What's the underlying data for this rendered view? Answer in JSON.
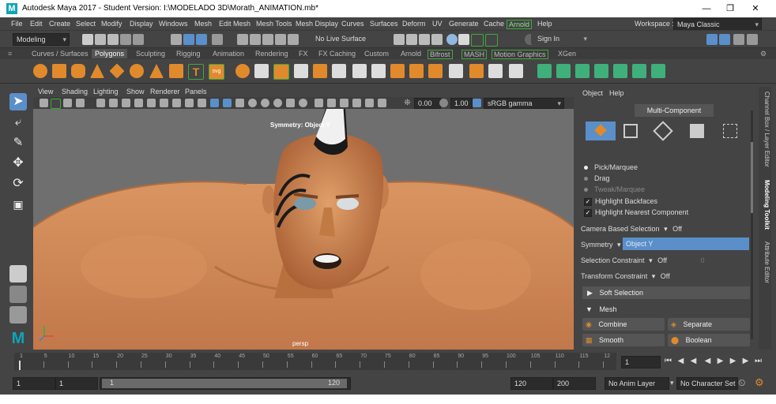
{
  "window": {
    "title": "Autodesk Maya 2017 - Student Version: I:\\MODELADO 3D\\Morath_ANIMATION.mb*",
    "app_icon": "M"
  },
  "menubar": {
    "items": [
      "File",
      "Edit",
      "Create",
      "Select",
      "Modify",
      "Display",
      "Windows",
      "Mesh",
      "Edit Mesh",
      "Mesh Tools",
      "Mesh Display",
      "Curves",
      "Surfaces",
      "Deform",
      "UV",
      "Generate",
      "Cache",
      "Arnold",
      "Help"
    ],
    "workspace_label": "Workspace :",
    "workspace_value": "Maya Classic"
  },
  "statusline": {
    "mode": "Modeling",
    "live_surface": "No Live Surface",
    "sign_in": "Sign In"
  },
  "shelf": {
    "tabs": [
      "Curves / Surfaces",
      "Polygons",
      "Sculpting",
      "Rigging",
      "Animation",
      "Rendering",
      "FX",
      "FX Caching",
      "Custom",
      "Arnold",
      "Bifrost",
      "MASH",
      "Motion Graphics",
      "XGen"
    ],
    "active_tab": "Polygons"
  },
  "viewport": {
    "menu": [
      "View",
      "Shading",
      "Lighting",
      "Show",
      "Renderer",
      "Panels"
    ],
    "exposure": "0.00",
    "gamma": "1.00",
    "color_space": "sRGB gamma",
    "symmetry_label": "Symmetry: Object Y",
    "camera_label": "persp"
  },
  "toolkit": {
    "menu": [
      "Object",
      "Help"
    ],
    "header": "Multi-Component",
    "pick_marquee": "Pick/Marquee",
    "drag": "Drag",
    "tweak_marquee": "Tweak/Marquee",
    "highlight_backfaces": "Highlight Backfaces",
    "highlight_nearest": "Highlight Nearest Component",
    "camera_based_label": "Camera Based Selection",
    "camera_based_value": "Off",
    "symmetry_label": "Symmetry",
    "symmetry_value": "Object Y",
    "selection_constraint_label": "Selection Constraint",
    "selection_constraint_value": "Off",
    "selection_constraint_num": "0",
    "transform_constraint_label": "Transform Constraint",
    "transform_constraint_value": "Off",
    "soft_selection": "Soft Selection",
    "mesh_section": "Mesh",
    "combine": "Combine",
    "separate": "Separate",
    "smooth": "Smooth",
    "boolean": "Boolean"
  },
  "side_tabs": [
    "Channel Box / Layer Editor",
    "Modeling Toolkit",
    "Attribute Editor"
  ],
  "timeline": {
    "ticks": [
      "1",
      "5",
      "10",
      "15",
      "20",
      "25",
      "30",
      "35",
      "40",
      "45",
      "50",
      "55",
      "60",
      "65",
      "70",
      "75",
      "80",
      "85",
      "90",
      "95",
      "100",
      "105",
      "110",
      "115",
      "12"
    ],
    "current_frame": "1"
  },
  "range": {
    "start": "1",
    "playback_start": "1",
    "slider_start": "1",
    "slider_end": "120",
    "playback_end": "120",
    "end": "200",
    "anim_layer": "No Anim Layer",
    "character_set": "No Character Set"
  }
}
